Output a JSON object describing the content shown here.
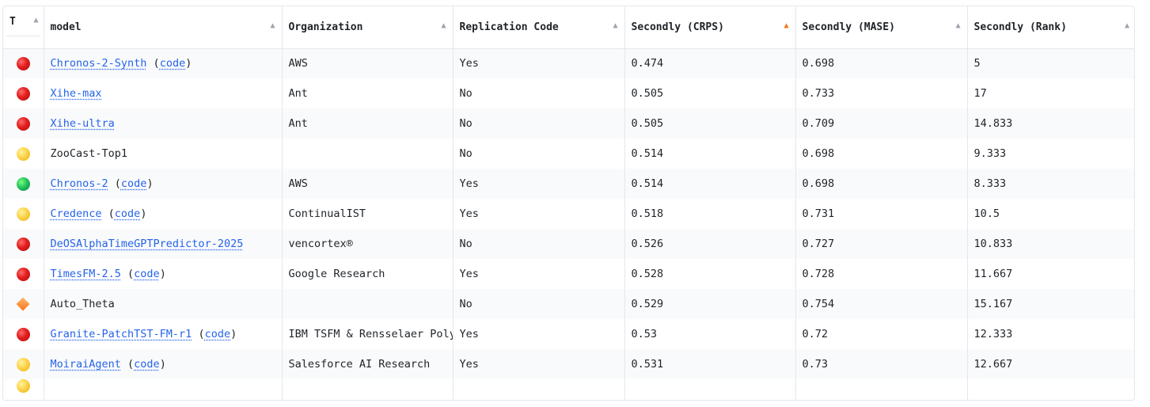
{
  "columns": [
    {
      "key": "type",
      "label": "T",
      "sort": "▲",
      "active": false
    },
    {
      "key": "model",
      "label": "model",
      "sort": "▲",
      "active": false
    },
    {
      "key": "org",
      "label": "Organization",
      "sort": "▲",
      "active": false
    },
    {
      "key": "repl",
      "label": "Replication Code",
      "sort": "▲",
      "active": false
    },
    {
      "key": "crps",
      "label": "Secondly (CRPS)",
      "sort": "▲",
      "active": true
    },
    {
      "key": "mase",
      "label": "Secondly (MASE)",
      "sort": "▲",
      "active": false
    },
    {
      "key": "rank",
      "label": "Secondly (Rank)",
      "sort": "▲",
      "active": false
    }
  ],
  "icons": {
    "red": "red-circle-icon",
    "yellow": "yellow-circle-icon",
    "green": "green-circle-icon",
    "orange": "orange-diamond-icon"
  },
  "rows": [
    {
      "type": "red",
      "model": "Chronos-2-Synth",
      "model_link": true,
      "code": "code",
      "org": "AWS",
      "repl": "Yes",
      "crps": "0.474",
      "mase": "0.698",
      "rank": "5"
    },
    {
      "type": "red",
      "model": "Xihe-max",
      "model_link": true,
      "code": "",
      "org": "Ant",
      "repl": "No",
      "crps": "0.505",
      "mase": "0.733",
      "rank": "17"
    },
    {
      "type": "red",
      "model": "Xihe-ultra",
      "model_link": true,
      "code": "",
      "org": "Ant",
      "repl": "No",
      "crps": "0.505",
      "mase": "0.709",
      "rank": "14.833"
    },
    {
      "type": "yellow",
      "model": "ZooCast-Top1",
      "model_link": false,
      "code": "",
      "org": "",
      "repl": "No",
      "crps": "0.514",
      "mase": "0.698",
      "rank": "9.333"
    },
    {
      "type": "green",
      "model": "Chronos-2",
      "model_link": true,
      "code": "code",
      "org": "AWS",
      "repl": "Yes",
      "crps": "0.514",
      "mase": "0.698",
      "rank": "8.333"
    },
    {
      "type": "yellow",
      "model": "Credence",
      "model_link": true,
      "code": "code",
      "org": "ContinualIST",
      "repl": "Yes",
      "crps": "0.518",
      "mase": "0.731",
      "rank": "10.5"
    },
    {
      "type": "red",
      "model": "DeOSAlphaTimeGPTPredictor-2025",
      "model_link": true,
      "code": "",
      "org": "vencortex®",
      "repl": "No",
      "crps": "0.526",
      "mase": "0.727",
      "rank": "10.833"
    },
    {
      "type": "red",
      "model": "TimesFM-2.5",
      "model_link": true,
      "code": "code",
      "org": "Google Research",
      "repl": "Yes",
      "crps": "0.528",
      "mase": "0.728",
      "rank": "11.667"
    },
    {
      "type": "orange",
      "model": "Auto_Theta",
      "model_link": false,
      "code": "",
      "org": "",
      "repl": "No",
      "crps": "0.529",
      "mase": "0.754",
      "rank": "15.167"
    },
    {
      "type": "red",
      "model": "Granite-PatchTST-FM-r1",
      "model_link": true,
      "code": "code",
      "org": "IBM TSFM & Rensselaer Polytechnic Institute",
      "repl": "Yes",
      "crps": "0.53",
      "mase": "0.72",
      "rank": "12.333"
    },
    {
      "type": "yellow",
      "model": "MoiraiAgent",
      "model_link": true,
      "code": "code",
      "org": "Salesforce AI Research",
      "repl": "Yes",
      "crps": "0.531",
      "mase": "0.73",
      "rank": "12.667"
    }
  ],
  "partial_row_type": "yellow"
}
